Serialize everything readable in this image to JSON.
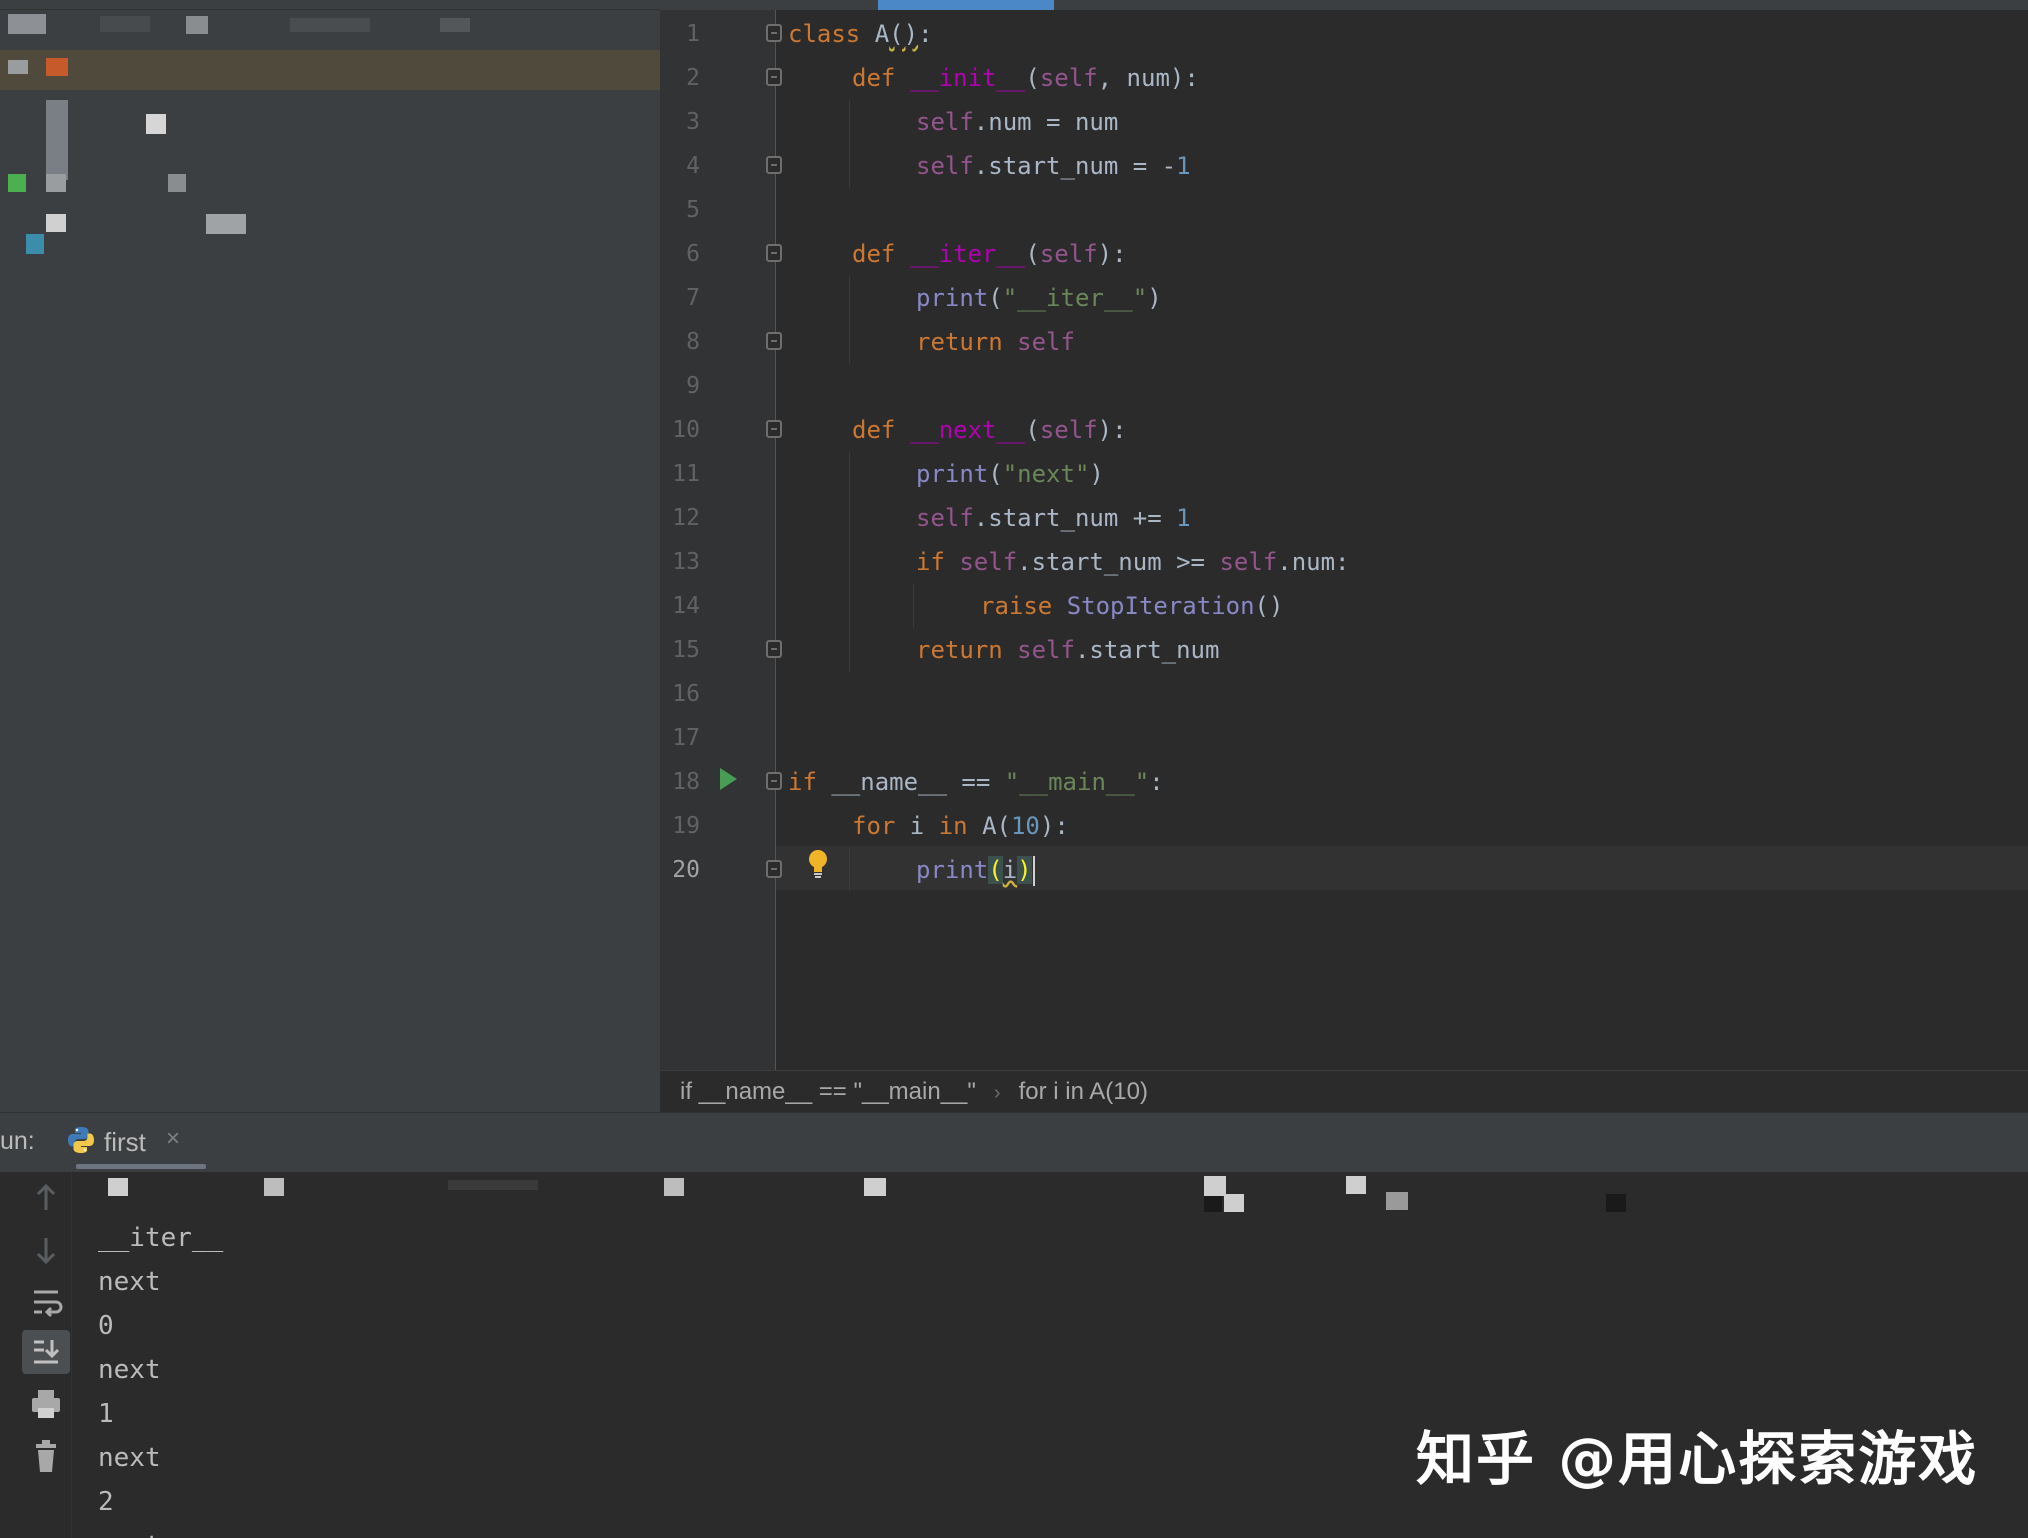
{
  "editor": {
    "lines": [
      {
        "n": "1"
      },
      {
        "n": "2"
      },
      {
        "n": "3"
      },
      {
        "n": "4"
      },
      {
        "n": "5"
      },
      {
        "n": "6"
      },
      {
        "n": "7"
      },
      {
        "n": "8"
      },
      {
        "n": "9"
      },
      {
        "n": "10"
      },
      {
        "n": "11"
      },
      {
        "n": "12"
      },
      {
        "n": "13"
      },
      {
        "n": "14"
      },
      {
        "n": "15"
      },
      {
        "n": "16"
      },
      {
        "n": "17"
      },
      {
        "n": "18"
      },
      {
        "n": "19"
      },
      {
        "n": "20"
      }
    ],
    "code": {
      "l1": [
        "class",
        " A",
        "()",
        ":"
      ],
      "l2": [
        "def",
        " ",
        "__init__",
        "(",
        "self",
        ", num):"
      ],
      "l3": [
        "self",
        ".num = num"
      ],
      "l4": [
        "self",
        ".start_num = -",
        "1"
      ],
      "l6": [
        "def",
        " ",
        "__iter__",
        "(",
        "self",
        "):"
      ],
      "l7": [
        "print",
        "(",
        "\"__iter__\"",
        ")"
      ],
      "l8": [
        "return",
        " ",
        "self"
      ],
      "l10": [
        "def",
        " ",
        "__next__",
        "(",
        "self",
        "):"
      ],
      "l11": [
        "print",
        "(",
        "\"next\"",
        ")"
      ],
      "l12": [
        "self",
        ".start_num += ",
        "1"
      ],
      "l13": [
        "if",
        " ",
        "self",
        ".start_num >= ",
        "self",
        ".num:"
      ],
      "l14": [
        "raise",
        " ",
        "StopIteration",
        "()"
      ],
      "l15": [
        "return",
        " ",
        "self",
        ".start_num"
      ],
      "l18": [
        "if",
        " __name__ == ",
        "\"__main__\"",
        ":"
      ],
      "l19": [
        "for",
        " i ",
        "in",
        " A(",
        "10",
        "):"
      ],
      "l20": [
        "print",
        "(",
        "i",
        ")"
      ]
    }
  },
  "breadcrumb": {
    "items": [
      "if __name__ == \"__main__\"",
      "for i in A(10)"
    ],
    "separator": "›"
  },
  "run": {
    "label": "un:",
    "tab": {
      "title": "first",
      "close": "×"
    },
    "output": [
      "__iter__",
      "next",
      "0",
      "next",
      "1",
      "next",
      "2",
      "next"
    ]
  },
  "watermark": "知乎 @用心探索游戏",
  "colors": {
    "keyword": "#cc7832",
    "function": "#b200b2",
    "self": "#94558d",
    "number": "#6897bb",
    "string": "#6a8759",
    "builtin": "#8888c6",
    "accent": "#4a88c7"
  }
}
